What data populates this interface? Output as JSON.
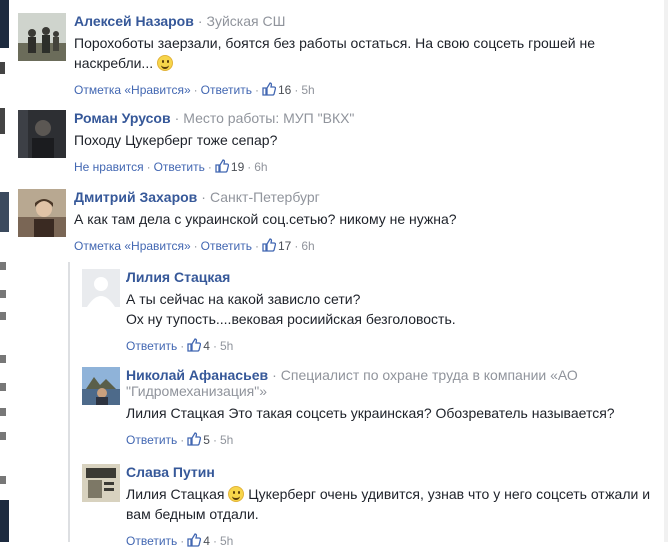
{
  "comments": [
    {
      "name": "Алексей Назаров",
      "meta": "Зуйская СШ",
      "text_1": "Порохоботы заерзали, боятся без работы остаться. На свою соцсеть грошей не",
      "text_2": "наскребли...",
      "action_1": "Отметка «Нравится»",
      "action_2": "Ответить",
      "likes": "16",
      "time": "5h"
    },
    {
      "name": "Роман Урусов",
      "meta": "Место работы: МУП \"ВКХ\"",
      "text_1": "Походу Цукерберг тоже сепар?",
      "action_1": "Не нравится",
      "action_2": "Ответить",
      "likes": "19",
      "time": "6h"
    },
    {
      "name": "Дмитрий Захаров",
      "meta": "Санкт-Петербург",
      "text_1": "А как там дела с украинской соц.сетью? никому не нужна?",
      "action_1": "Отметка «Нравится»",
      "action_2": "Ответить",
      "likes": "17",
      "time": "6h"
    }
  ],
  "replies": [
    {
      "name": "Лилия Стацкая",
      "text_1": "А ты сейчас на какой зависло сети?",
      "text_2": "Ох ну тупость....вековая росиийская безголовость.",
      "action": "Ответить",
      "likes": "4",
      "time": "5h"
    },
    {
      "name": "Николай Афанасьев",
      "meta_1": "Специалист по охране труда в компании «АО",
      "meta_2": "\"Гидромеханизация\"»",
      "text_1": "Лилия Стацкая Это такая соцсеть украинская? Обозреватель называется?",
      "action": "Ответить",
      "likes": "5",
      "time": "5h"
    },
    {
      "name": "Слава Путин",
      "text_mention": "Лилия Стацкая",
      "text_1": "Цукерберг очень удивится, узнав что у него соцсеть отжали и",
      "text_2": "вам бедным отдали.",
      "action": "Ответить",
      "likes": "4",
      "time": "5h"
    }
  ],
  "colors": {
    "name": "#365899",
    "link": "#4267b2",
    "meta": "#90949c",
    "text": "#1d2129"
  },
  "icons": [
    "like-thumb-icon",
    "smile-emoji-icon",
    "grin-emoji-icon"
  ]
}
